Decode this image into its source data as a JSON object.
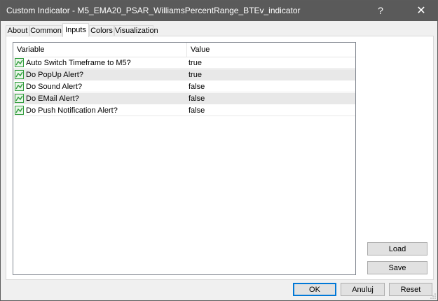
{
  "window": {
    "title": "Custom Indicator - M5_EMA20_PSAR_WilliamsPercentRange_BTEv_indicator",
    "help_label": "?",
    "close_label": "✕"
  },
  "tabs": [
    {
      "label": "About",
      "active": false
    },
    {
      "label": "Common",
      "active": false
    },
    {
      "label": "Inputs",
      "active": true
    },
    {
      "label": "Colors",
      "active": false
    },
    {
      "label": "Visualization",
      "active": false
    }
  ],
  "grid": {
    "columns": {
      "variable": "Variable",
      "value": "Value"
    },
    "rows": [
      {
        "variable": "Auto Switch Timeframe to M5?",
        "value": "true",
        "icon": "input-parameter-icon"
      },
      {
        "variable": "Do PopUp Alert?",
        "value": "true",
        "icon": "input-parameter-icon"
      },
      {
        "variable": "Do Sound Alert?",
        "value": "false",
        "icon": "input-parameter-icon"
      },
      {
        "variable": "Do EMail Alert?",
        "value": "false",
        "icon": "input-parameter-icon"
      },
      {
        "variable": "Do Push Notification Alert?",
        "value": "false",
        "icon": "input-parameter-icon"
      }
    ]
  },
  "side_buttons": {
    "load": "Load",
    "save": "Save"
  },
  "footer_buttons": {
    "ok": "OK",
    "cancel": "Anuluj",
    "reset": "Reset"
  },
  "colors": {
    "titlebar": "#5a5a5a",
    "icon_green": "#2e9b3a",
    "alt_row": "#e8e8e8",
    "default_button_border": "#0078d7"
  }
}
